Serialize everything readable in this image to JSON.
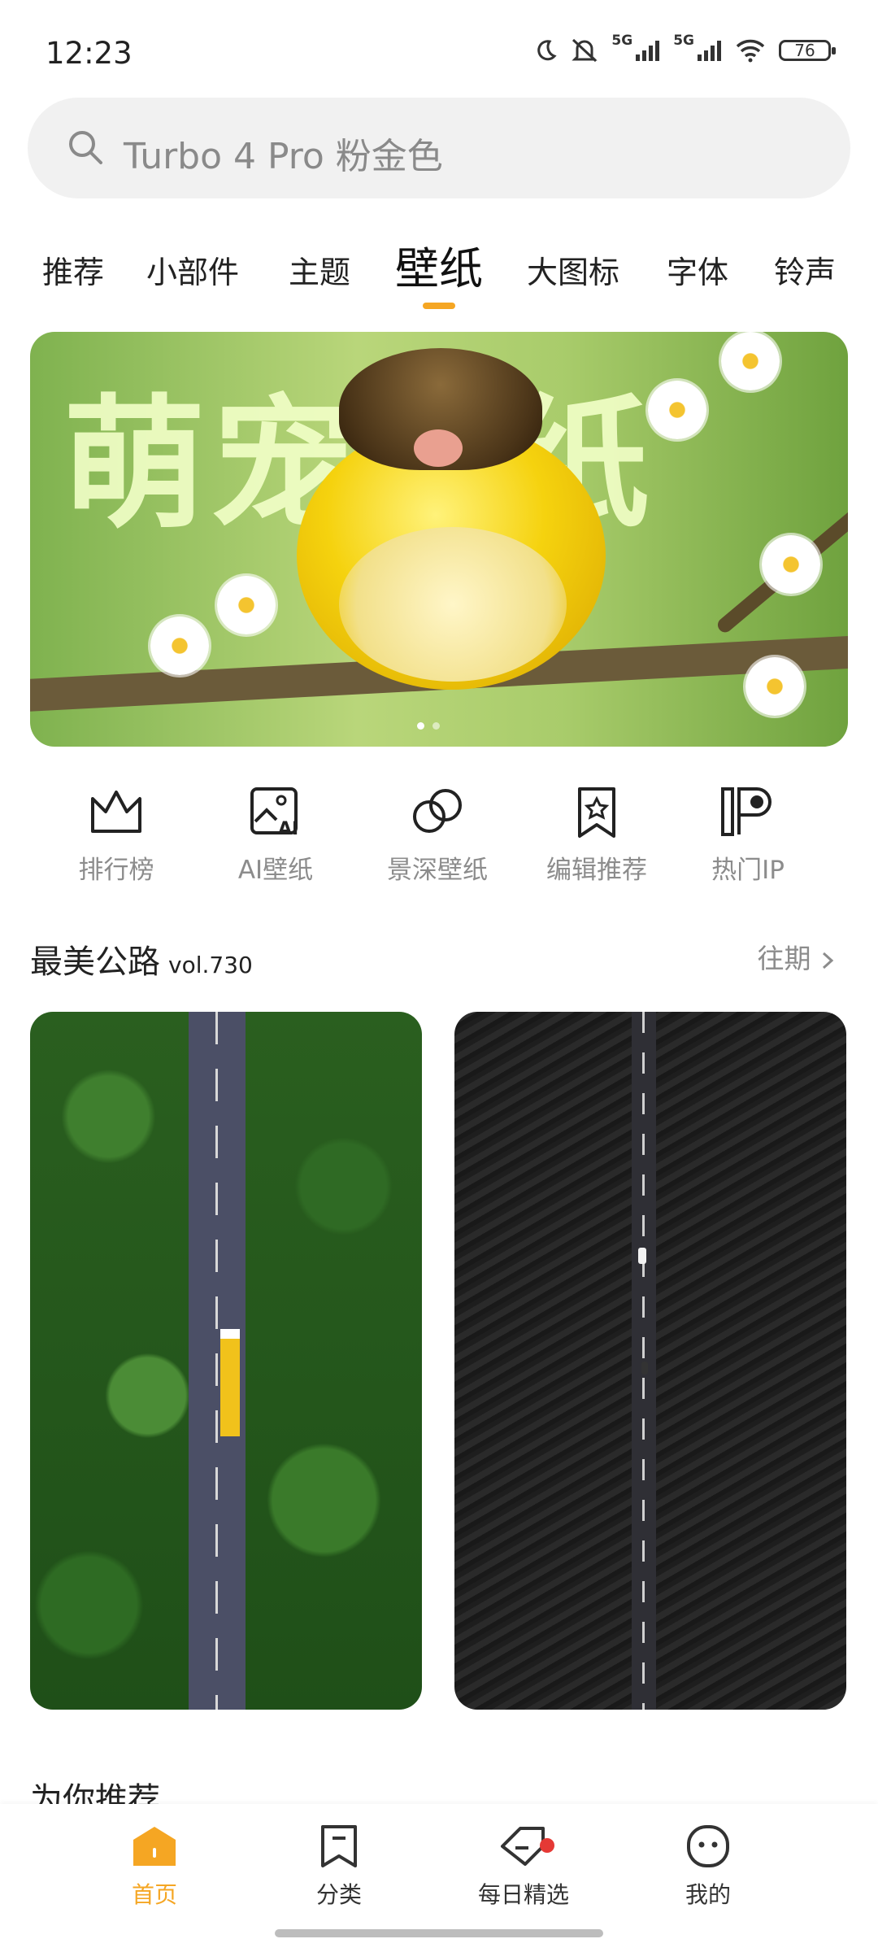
{
  "status_bar": {
    "time": "12:23",
    "battery": "76",
    "signal1": "5G",
    "signal2": "5G"
  },
  "search": {
    "placeholder": "Turbo 4 Pro 粉金色"
  },
  "tabs": [
    {
      "label": "推荐"
    },
    {
      "label": "小部件"
    },
    {
      "label": "主题"
    },
    {
      "label": "壁纸",
      "active": true
    },
    {
      "label": "大图标"
    },
    {
      "label": "字体"
    },
    {
      "label": "铃声"
    }
  ],
  "banner": {
    "title": "萌宠壁纸",
    "page_count": 2,
    "active_page": 1
  },
  "categories": [
    {
      "label": "排行榜",
      "icon": "crown-icon"
    },
    {
      "label": "AI壁纸",
      "icon": "ai-image-icon"
    },
    {
      "label": "景深壁纸",
      "icon": "overlap-circles-icon"
    },
    {
      "label": "编辑推荐",
      "icon": "bookmark-star-icon"
    },
    {
      "label": "热门IP",
      "icon": "ip-icon"
    }
  ],
  "featured": {
    "title": "最美公路",
    "vol": "vol.730",
    "more": "往期"
  },
  "next_section": {
    "title": "为你推荐"
  },
  "bottom_nav": [
    {
      "label": "首页",
      "icon": "home-icon",
      "active": true
    },
    {
      "label": "分类",
      "icon": "bookmark-icon"
    },
    {
      "label": "每日精选",
      "icon": "diamond-tag-icon",
      "badge": true
    },
    {
      "label": "我的",
      "icon": "face-icon"
    }
  ],
  "colors": {
    "accent": "#f5a623",
    "badge": "#e53935"
  }
}
